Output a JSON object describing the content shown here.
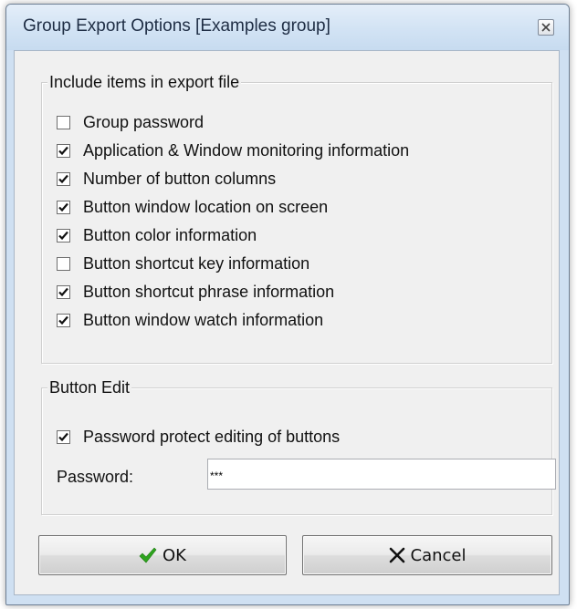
{
  "window": {
    "title": "Group Export Options  [Examples group]"
  },
  "include_group": {
    "legend": "Include items in export file",
    "items": [
      {
        "label": "Group password",
        "checked": false
      },
      {
        "label": "Application & Window monitoring information",
        "checked": true
      },
      {
        "label": "Number of button columns",
        "checked": true
      },
      {
        "label": "Button window location on screen",
        "checked": true
      },
      {
        "label": "Button color information",
        "checked": true
      },
      {
        "label": "Button shortcut key information",
        "checked": false
      },
      {
        "label": "Button shortcut phrase information",
        "checked": true
      },
      {
        "label": "Button window watch information",
        "checked": true
      }
    ]
  },
  "button_edit_group": {
    "legend": "Button Edit",
    "protect": {
      "label": "Password protect editing of buttons",
      "checked": true
    },
    "password_label": "Password:",
    "password_value": "***"
  },
  "buttons": {
    "ok_label": "OK",
    "cancel_label": "Cancel"
  },
  "colors": {
    "ok_check": "#2ea41e",
    "cancel_x": "#111111",
    "title_bar": "#d2e3f4",
    "dialog_face": "#f0f0f0"
  },
  "icons": {
    "ok": "check-icon",
    "cancel": "x-icon",
    "close": "close-icon"
  }
}
